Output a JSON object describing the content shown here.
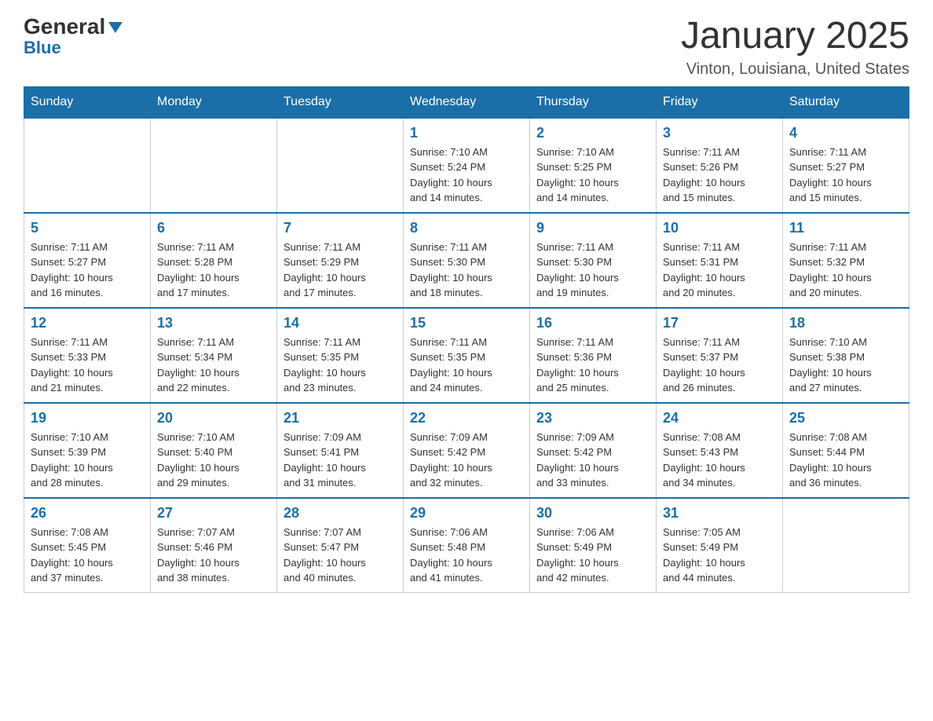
{
  "logo": {
    "text_general": "General",
    "text_blue": "Blue",
    "arrow": "▶"
  },
  "header": {
    "title": "January 2025",
    "subtitle": "Vinton, Louisiana, United States"
  },
  "days_of_week": [
    "Sunday",
    "Monday",
    "Tuesday",
    "Wednesday",
    "Thursday",
    "Friday",
    "Saturday"
  ],
  "weeks": [
    [
      {
        "day": "",
        "info": ""
      },
      {
        "day": "",
        "info": ""
      },
      {
        "day": "",
        "info": ""
      },
      {
        "day": "1",
        "info": "Sunrise: 7:10 AM\nSunset: 5:24 PM\nDaylight: 10 hours\nand 14 minutes."
      },
      {
        "day": "2",
        "info": "Sunrise: 7:10 AM\nSunset: 5:25 PM\nDaylight: 10 hours\nand 14 minutes."
      },
      {
        "day": "3",
        "info": "Sunrise: 7:11 AM\nSunset: 5:26 PM\nDaylight: 10 hours\nand 15 minutes."
      },
      {
        "day": "4",
        "info": "Sunrise: 7:11 AM\nSunset: 5:27 PM\nDaylight: 10 hours\nand 15 minutes."
      }
    ],
    [
      {
        "day": "5",
        "info": "Sunrise: 7:11 AM\nSunset: 5:27 PM\nDaylight: 10 hours\nand 16 minutes."
      },
      {
        "day": "6",
        "info": "Sunrise: 7:11 AM\nSunset: 5:28 PM\nDaylight: 10 hours\nand 17 minutes."
      },
      {
        "day": "7",
        "info": "Sunrise: 7:11 AM\nSunset: 5:29 PM\nDaylight: 10 hours\nand 17 minutes."
      },
      {
        "day": "8",
        "info": "Sunrise: 7:11 AM\nSunset: 5:30 PM\nDaylight: 10 hours\nand 18 minutes."
      },
      {
        "day": "9",
        "info": "Sunrise: 7:11 AM\nSunset: 5:30 PM\nDaylight: 10 hours\nand 19 minutes."
      },
      {
        "day": "10",
        "info": "Sunrise: 7:11 AM\nSunset: 5:31 PM\nDaylight: 10 hours\nand 20 minutes."
      },
      {
        "day": "11",
        "info": "Sunrise: 7:11 AM\nSunset: 5:32 PM\nDaylight: 10 hours\nand 20 minutes."
      }
    ],
    [
      {
        "day": "12",
        "info": "Sunrise: 7:11 AM\nSunset: 5:33 PM\nDaylight: 10 hours\nand 21 minutes."
      },
      {
        "day": "13",
        "info": "Sunrise: 7:11 AM\nSunset: 5:34 PM\nDaylight: 10 hours\nand 22 minutes."
      },
      {
        "day": "14",
        "info": "Sunrise: 7:11 AM\nSunset: 5:35 PM\nDaylight: 10 hours\nand 23 minutes."
      },
      {
        "day": "15",
        "info": "Sunrise: 7:11 AM\nSunset: 5:35 PM\nDaylight: 10 hours\nand 24 minutes."
      },
      {
        "day": "16",
        "info": "Sunrise: 7:11 AM\nSunset: 5:36 PM\nDaylight: 10 hours\nand 25 minutes."
      },
      {
        "day": "17",
        "info": "Sunrise: 7:11 AM\nSunset: 5:37 PM\nDaylight: 10 hours\nand 26 minutes."
      },
      {
        "day": "18",
        "info": "Sunrise: 7:10 AM\nSunset: 5:38 PM\nDaylight: 10 hours\nand 27 minutes."
      }
    ],
    [
      {
        "day": "19",
        "info": "Sunrise: 7:10 AM\nSunset: 5:39 PM\nDaylight: 10 hours\nand 28 minutes."
      },
      {
        "day": "20",
        "info": "Sunrise: 7:10 AM\nSunset: 5:40 PM\nDaylight: 10 hours\nand 29 minutes."
      },
      {
        "day": "21",
        "info": "Sunrise: 7:09 AM\nSunset: 5:41 PM\nDaylight: 10 hours\nand 31 minutes."
      },
      {
        "day": "22",
        "info": "Sunrise: 7:09 AM\nSunset: 5:42 PM\nDaylight: 10 hours\nand 32 minutes."
      },
      {
        "day": "23",
        "info": "Sunrise: 7:09 AM\nSunset: 5:42 PM\nDaylight: 10 hours\nand 33 minutes."
      },
      {
        "day": "24",
        "info": "Sunrise: 7:08 AM\nSunset: 5:43 PM\nDaylight: 10 hours\nand 34 minutes."
      },
      {
        "day": "25",
        "info": "Sunrise: 7:08 AM\nSunset: 5:44 PM\nDaylight: 10 hours\nand 36 minutes."
      }
    ],
    [
      {
        "day": "26",
        "info": "Sunrise: 7:08 AM\nSunset: 5:45 PM\nDaylight: 10 hours\nand 37 minutes."
      },
      {
        "day": "27",
        "info": "Sunrise: 7:07 AM\nSunset: 5:46 PM\nDaylight: 10 hours\nand 38 minutes."
      },
      {
        "day": "28",
        "info": "Sunrise: 7:07 AM\nSunset: 5:47 PM\nDaylight: 10 hours\nand 40 minutes."
      },
      {
        "day": "29",
        "info": "Sunrise: 7:06 AM\nSunset: 5:48 PM\nDaylight: 10 hours\nand 41 minutes."
      },
      {
        "day": "30",
        "info": "Sunrise: 7:06 AM\nSunset: 5:49 PM\nDaylight: 10 hours\nand 42 minutes."
      },
      {
        "day": "31",
        "info": "Sunrise: 7:05 AM\nSunset: 5:49 PM\nDaylight: 10 hours\nand 44 minutes."
      },
      {
        "day": "",
        "info": ""
      }
    ]
  ]
}
